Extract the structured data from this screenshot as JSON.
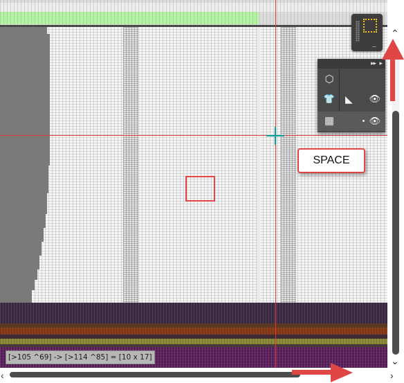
{
  "status": {
    "selection_readout": "[>105 ^69] -> [>114 ^85] = [10 x 17]"
  },
  "hint": {
    "key_label": "SPACE"
  },
  "layers_panel": {
    "expand_icon": "▸▸",
    "close_icon": "▸",
    "rows": [
      {
        "icon": "add-layer-icon",
        "glyph": "⬡",
        "visible": false
      },
      {
        "icon": "garment-icon",
        "glyph": "👕",
        "visible": true,
        "extra_icon": "pattern-icon",
        "extra_glyph": "◣"
      },
      {
        "icon": "grid-layer-icon",
        "glyph": "▦",
        "visible": true
      }
    ],
    "eye_glyph": "👁"
  },
  "navigator": {
    "dash": "–"
  },
  "scrollbars": {
    "up_glyph": "⌃",
    "down_glyph": "⌄",
    "left_glyph": "‹",
    "right_glyph": "›"
  },
  "colors": {
    "guide_red": "#e23a3a",
    "annotation_red": "#e04646",
    "crosshair_teal": "#0a9f9a",
    "ruler_green": "#b5f2a5",
    "navigator_gold": "#f0c419"
  }
}
